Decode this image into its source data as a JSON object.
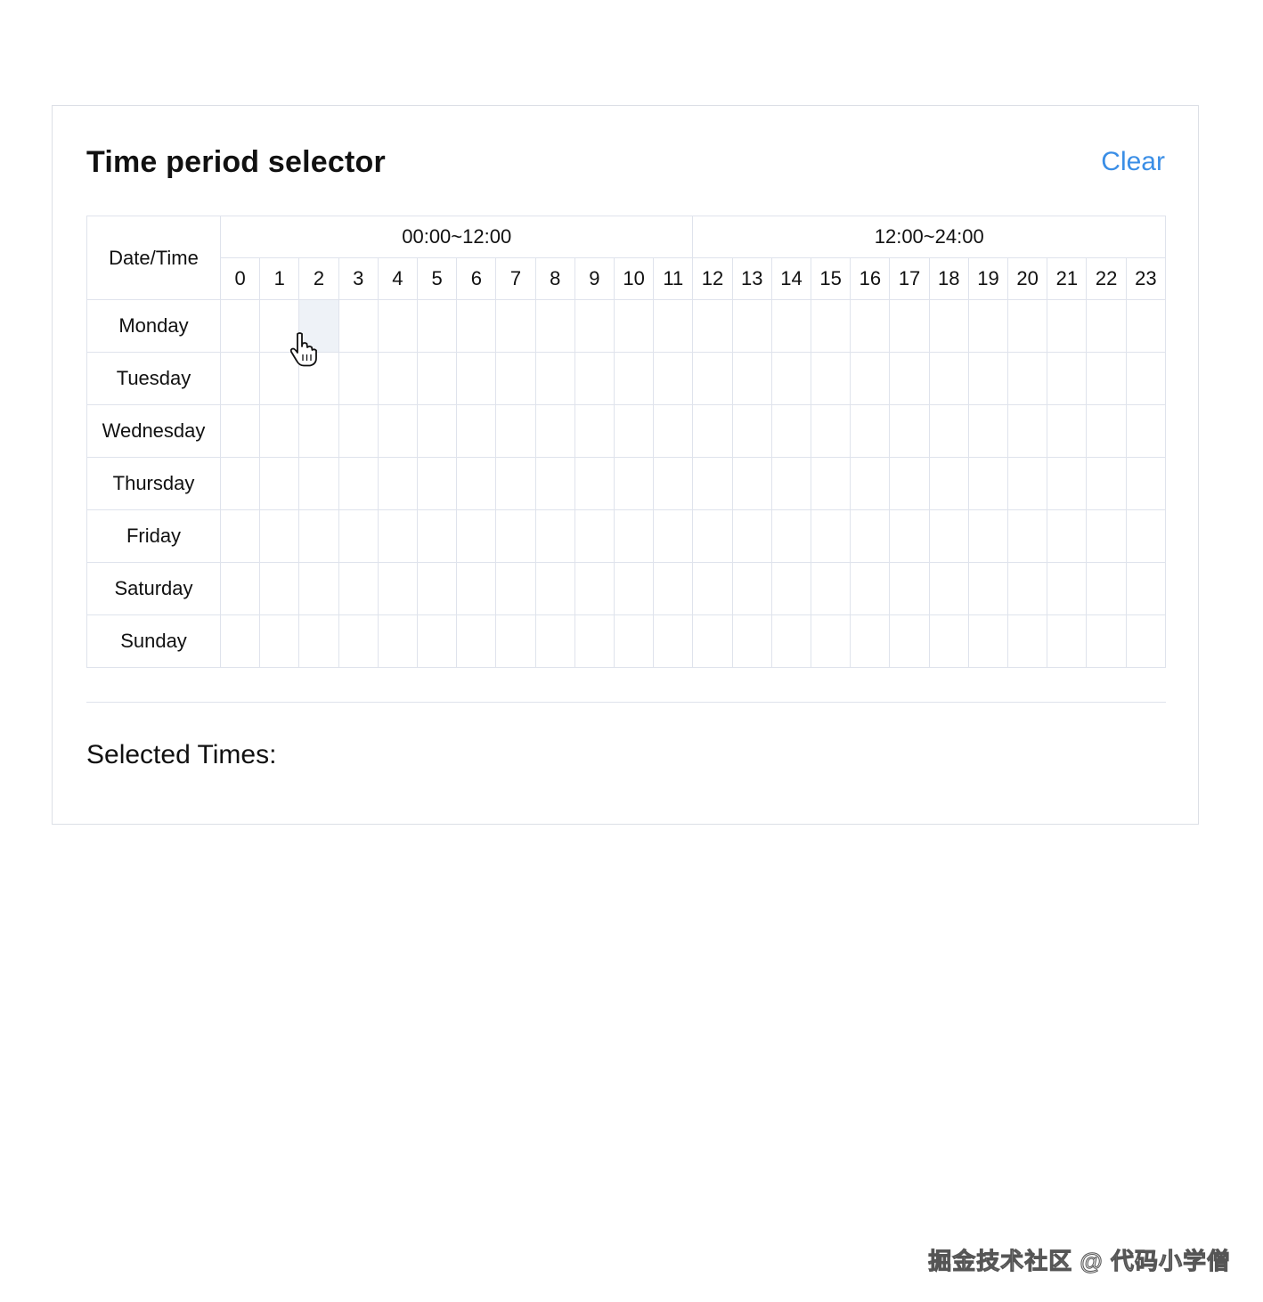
{
  "header": {
    "title": "Time period selector",
    "clear_label": "Clear"
  },
  "table": {
    "corner_label": "Date/Time",
    "halves": [
      "00:00~12:00",
      "12:00~24:00"
    ],
    "hours": [
      "0",
      "1",
      "2",
      "3",
      "4",
      "5",
      "6",
      "7",
      "8",
      "9",
      "10",
      "11",
      "12",
      "13",
      "14",
      "15",
      "16",
      "17",
      "18",
      "19",
      "20",
      "21",
      "22",
      "23"
    ],
    "days": [
      "Monday",
      "Tuesday",
      "Wednesday",
      "Thursday",
      "Friday",
      "Saturday",
      "Sunday"
    ],
    "hovered_cell": {
      "day": "Monday",
      "hour": "2"
    }
  },
  "footer": {
    "selected_label": "Selected Times:"
  },
  "icons": {
    "cursor": "hand-pointer-icon"
  },
  "colors": {
    "accent": "#3a8ee6",
    "border": "#dfe3ec",
    "hover": "#eef2f7"
  },
  "watermark": "掘金技术社区 @ 代码小学僧"
}
